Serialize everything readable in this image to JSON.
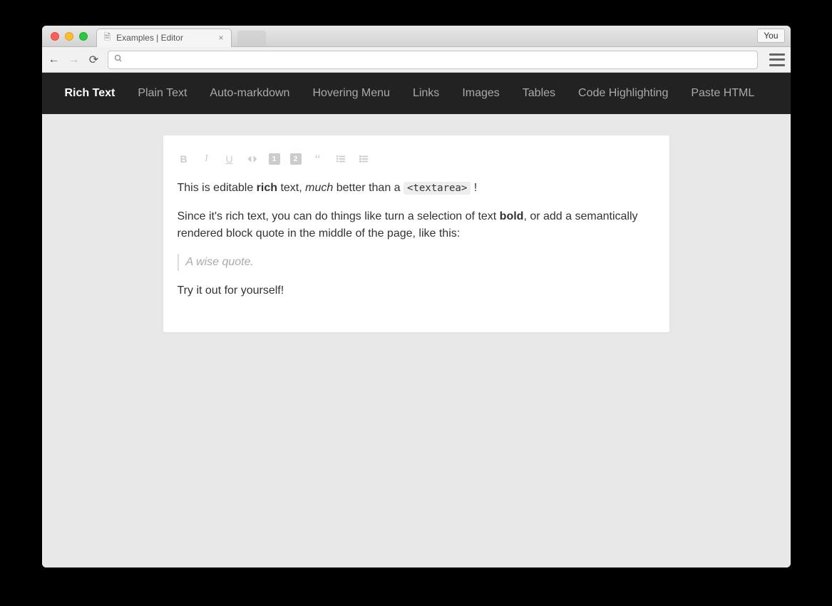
{
  "browser": {
    "tab_title": "Examples | Editor",
    "profile_label": "You",
    "address_value": ""
  },
  "nav": {
    "items": [
      {
        "label": "Rich Text",
        "active": true
      },
      {
        "label": "Plain Text",
        "active": false
      },
      {
        "label": "Auto-markdown",
        "active": false
      },
      {
        "label": "Hovering Menu",
        "active": false
      },
      {
        "label": "Links",
        "active": false
      },
      {
        "label": "Images",
        "active": false
      },
      {
        "label": "Tables",
        "active": false
      },
      {
        "label": "Code Highlighting",
        "active": false
      },
      {
        "label": "Paste HTML",
        "active": false
      }
    ]
  },
  "toolbar": {
    "bold": "B",
    "italic": "I",
    "underline": "U",
    "h1": "1",
    "h2": "2",
    "quote_glyph": "“"
  },
  "content": {
    "p1_a": "This is editable ",
    "p1_b": "rich",
    "p1_c": " text, ",
    "p1_d": "much",
    "p1_e": " better than a ",
    "p1_code": "<textarea>",
    "p1_f": " !",
    "p2_a": "Since it's rich text, you can do things like turn a selection of text ",
    "p2_b": "bold",
    "p2_c": ", or add a semantically rendered block quote in the middle of the page, like this:",
    "quote": "A wise quote.",
    "p3": "Try it out for yourself!"
  }
}
